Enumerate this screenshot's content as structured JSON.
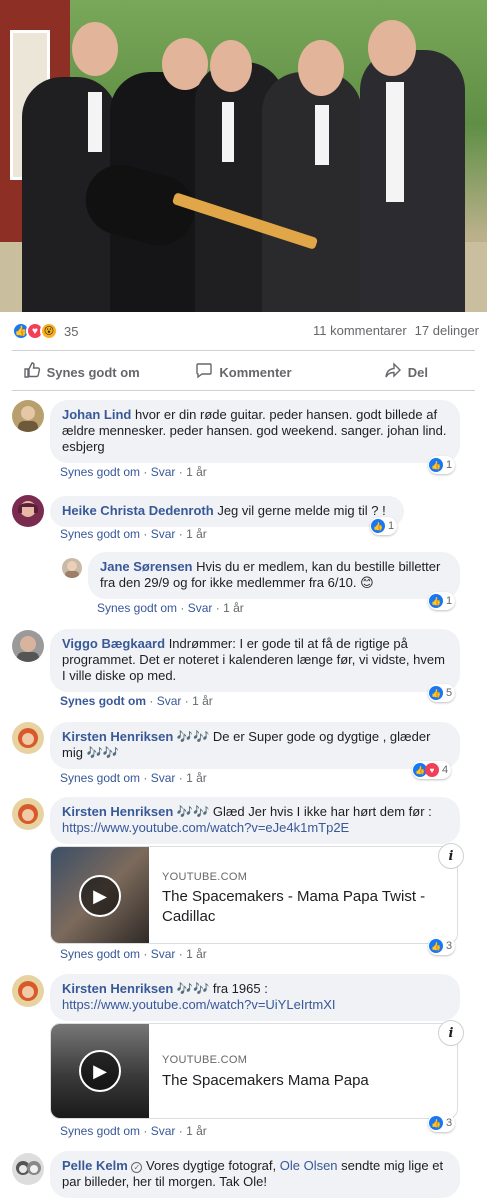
{
  "post": {
    "reaction_count": "35",
    "comments_count": "11 kommentarer",
    "shares_count": "17 delinger"
  },
  "actions": {
    "like": "Synes godt om",
    "comment": "Kommenter",
    "share": "Del"
  },
  "comment_meta": {
    "like": "Synes godt om",
    "reply": "Svar",
    "sep": "·"
  },
  "comments": [
    {
      "name": "Johan Lind",
      "text": "hvor er din røde guitar. peder hansen. godt billede af ældre mennesker. peder hansen. god weekend. sanger. johan lind. esbjerg",
      "time": "1 år",
      "reactions": "1"
    },
    {
      "name": "Heike Christa Dedenroth",
      "text": "Jeg vil gerne melde mig til ? !",
      "time": "1 år",
      "reactions": "1"
    },
    {
      "name": "Jane Sørensen",
      "text": "Hvis du er medlem, kan du bestille billetter fra den 29/9 og for ikke medlemmer fra 6/10. 😊",
      "time": "1 år",
      "reactions": "1"
    },
    {
      "name": "Viggo Bægkaard",
      "text": "Indrømmer: I er gode til at få de rigtige på programmet. Det er noteret i kalenderen længe før, vi vidste, hvem I ville diske op med.",
      "time": "1 år",
      "reactions": "5"
    },
    {
      "name": "Kirsten Henriksen 🎶🎶",
      "text": "De er Super gode og dygtige , glæder mig 🎶🎶",
      "time": "1 år",
      "reactions": "4"
    },
    {
      "name": "Kirsten Henriksen 🎶🎶",
      "text": "Glæd Jer hvis I ikke har hørt dem før :",
      "link": "https://www.youtube.com/watch?v=eJe4k1mTp2E",
      "preview_domain": "YOUTUBE.COM",
      "preview_title": "The Spacemakers - Mama Papa Twist - Cadillac",
      "time": "1 år",
      "reactions": "3"
    },
    {
      "name": "Kirsten Henriksen 🎶🎶",
      "text": "fra 1965 :",
      "link": "https://www.youtube.com/watch?v=UiYLeIrtmXI",
      "preview_domain": "YOUTUBE.COM",
      "preview_title": "The Spacemakers Mama Papa",
      "time": "1 år",
      "reactions": "3"
    },
    {
      "name": "Pelle Kelm",
      "text_before": "Vores dygtige fotograf,",
      "mention": "Ole Olsen",
      "text_after": "sendte mig lige et par billeder, her til morgen. Tak Ole!"
    }
  ],
  "colors": {
    "link": "#385898",
    "like_blue": "#1877f2",
    "love_red": "#f33e58",
    "bubble_bg": "#f0f2f5",
    "muted": "#65676b"
  },
  "icons": {
    "like": "thumbs-up-icon",
    "comment": "speech-bubble-icon",
    "share": "share-arrow-icon",
    "info": "info-icon",
    "play": "play-icon"
  }
}
